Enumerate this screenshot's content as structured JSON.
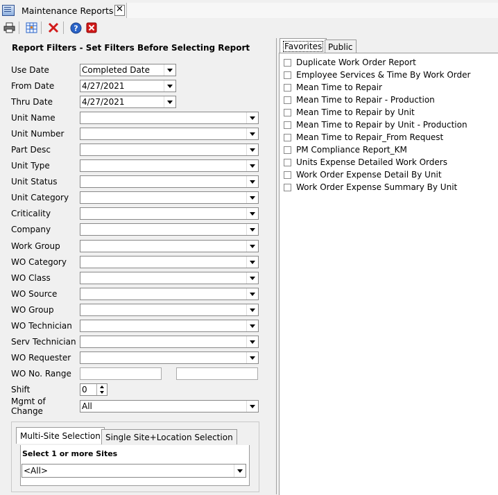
{
  "window": {
    "title": "Maintenance Reports"
  },
  "filters": {
    "heading": "Report Filters - Set Filters Before Selecting Report",
    "use_date": {
      "label": "Use Date",
      "value": "Completed Date"
    },
    "from_date": {
      "label": "From Date",
      "value": "4/27/2021"
    },
    "thru_date": {
      "label": "Thru Date",
      "value": "4/27/2021"
    },
    "combos": [
      {
        "label": "Unit Name",
        "value": ""
      },
      {
        "label": "Unit Number",
        "value": ""
      },
      {
        "label": "Part Desc",
        "value": ""
      },
      {
        "label": "Unit Type",
        "value": ""
      },
      {
        "label": "Unit Status",
        "value": ""
      },
      {
        "label": "Unit Category",
        "value": ""
      },
      {
        "label": "Criticality",
        "value": ""
      },
      {
        "label": "Company",
        "value": ""
      },
      {
        "label": "Work Group",
        "value": ""
      },
      {
        "label": "WO Category",
        "value": ""
      },
      {
        "label": "WO Class",
        "value": ""
      },
      {
        "label": "WO Source",
        "value": ""
      },
      {
        "label": "WO Group",
        "value": ""
      },
      {
        "label": "WO Technician",
        "value": ""
      },
      {
        "label": "Serv Technician",
        "value": ""
      },
      {
        "label": "WO Requester",
        "value": ""
      }
    ],
    "wo_range": {
      "label": "WO No. Range",
      "from": "",
      "to": ""
    },
    "shift": {
      "label": "Shift",
      "value": "0"
    },
    "mgmt_change": {
      "label": "Mgmt of Change",
      "value": "All"
    }
  },
  "sites": {
    "tabs": [
      "Multi-Site Selection",
      "Single Site+Location Selection"
    ],
    "label": "Select 1 or more Sites",
    "value": "<All>"
  },
  "reports": {
    "tabs": [
      "Favorites",
      "Public"
    ],
    "items": [
      "Duplicate Work Order Report",
      "Employee Services & Time By Work Order",
      "Mean Time to Repair",
      "Mean Time to Repair - Production",
      "Mean Time to Repair by Unit",
      "Mean Time to Repair by Unit - Production",
      "Mean Time to Repair_From Request",
      "PM Compliance Report_KM",
      "Units Expense Detailed Work Orders",
      "Work Order Expense Detail By Unit",
      "Work Order Expense Summary By Unit"
    ]
  },
  "colors": {
    "accent_blue": "#2a63c7",
    "delete_red": "#d11a1a"
  }
}
